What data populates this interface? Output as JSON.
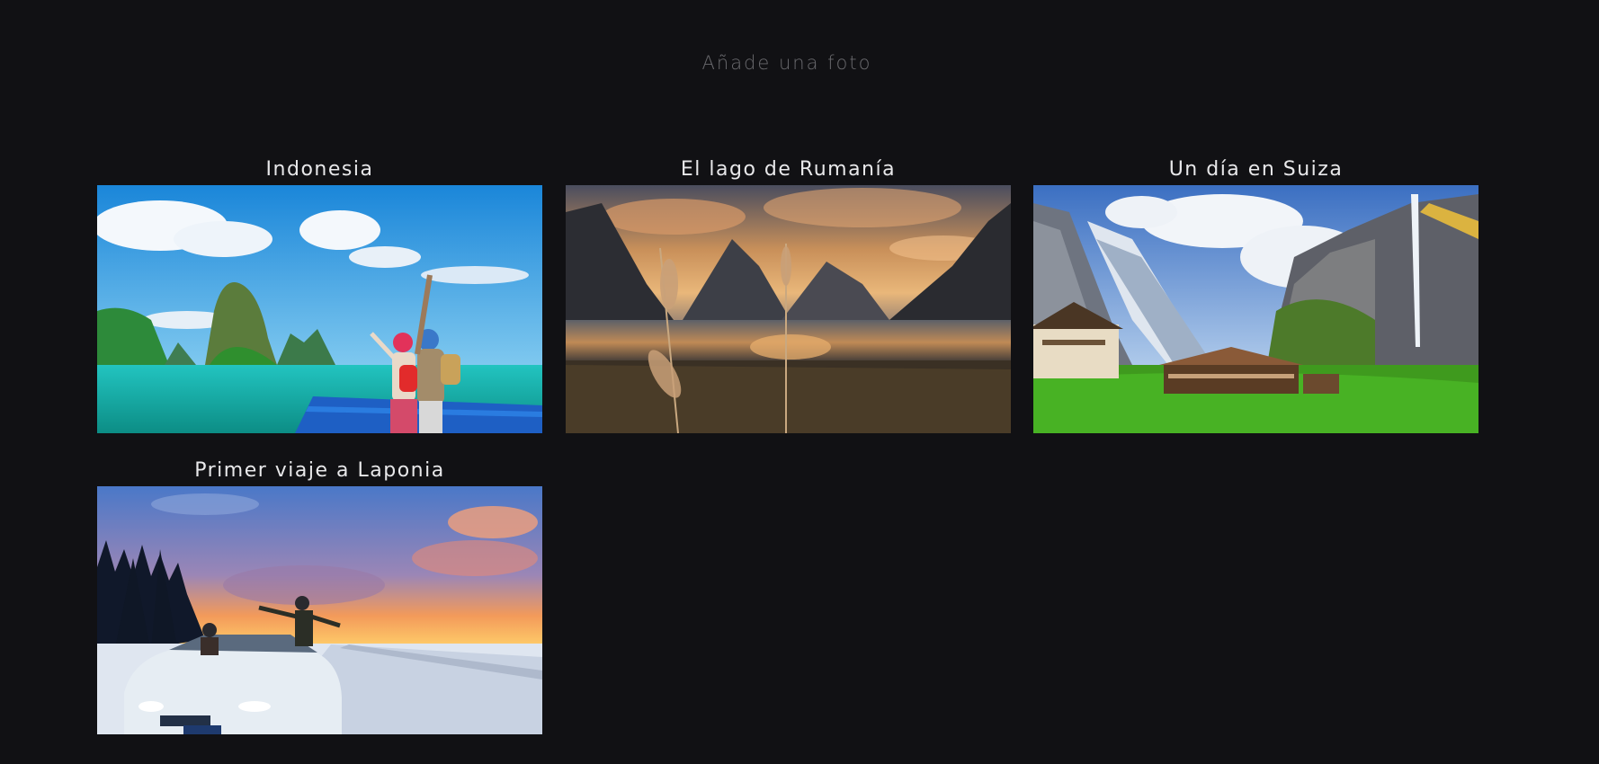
{
  "header": {
    "add_photo_label": "Añade una foto"
  },
  "gallery": {
    "cards": [
      {
        "title": "Indonesia",
        "photo_icon": "beach-travelers-photo"
      },
      {
        "title": "El lago de Rumanía",
        "photo_icon": "mountain-lake-sunset-photo"
      },
      {
        "title": "Un día en Suiza",
        "photo_icon": "alpine-village-photo"
      },
      {
        "title": "Primer viaje a Laponia",
        "photo_icon": "snowy-road-car-photo"
      }
    ]
  },
  "colors": {
    "background": "#111114",
    "title_text": "#e8e8ea",
    "add_photo_text": "#6a6a6e"
  }
}
